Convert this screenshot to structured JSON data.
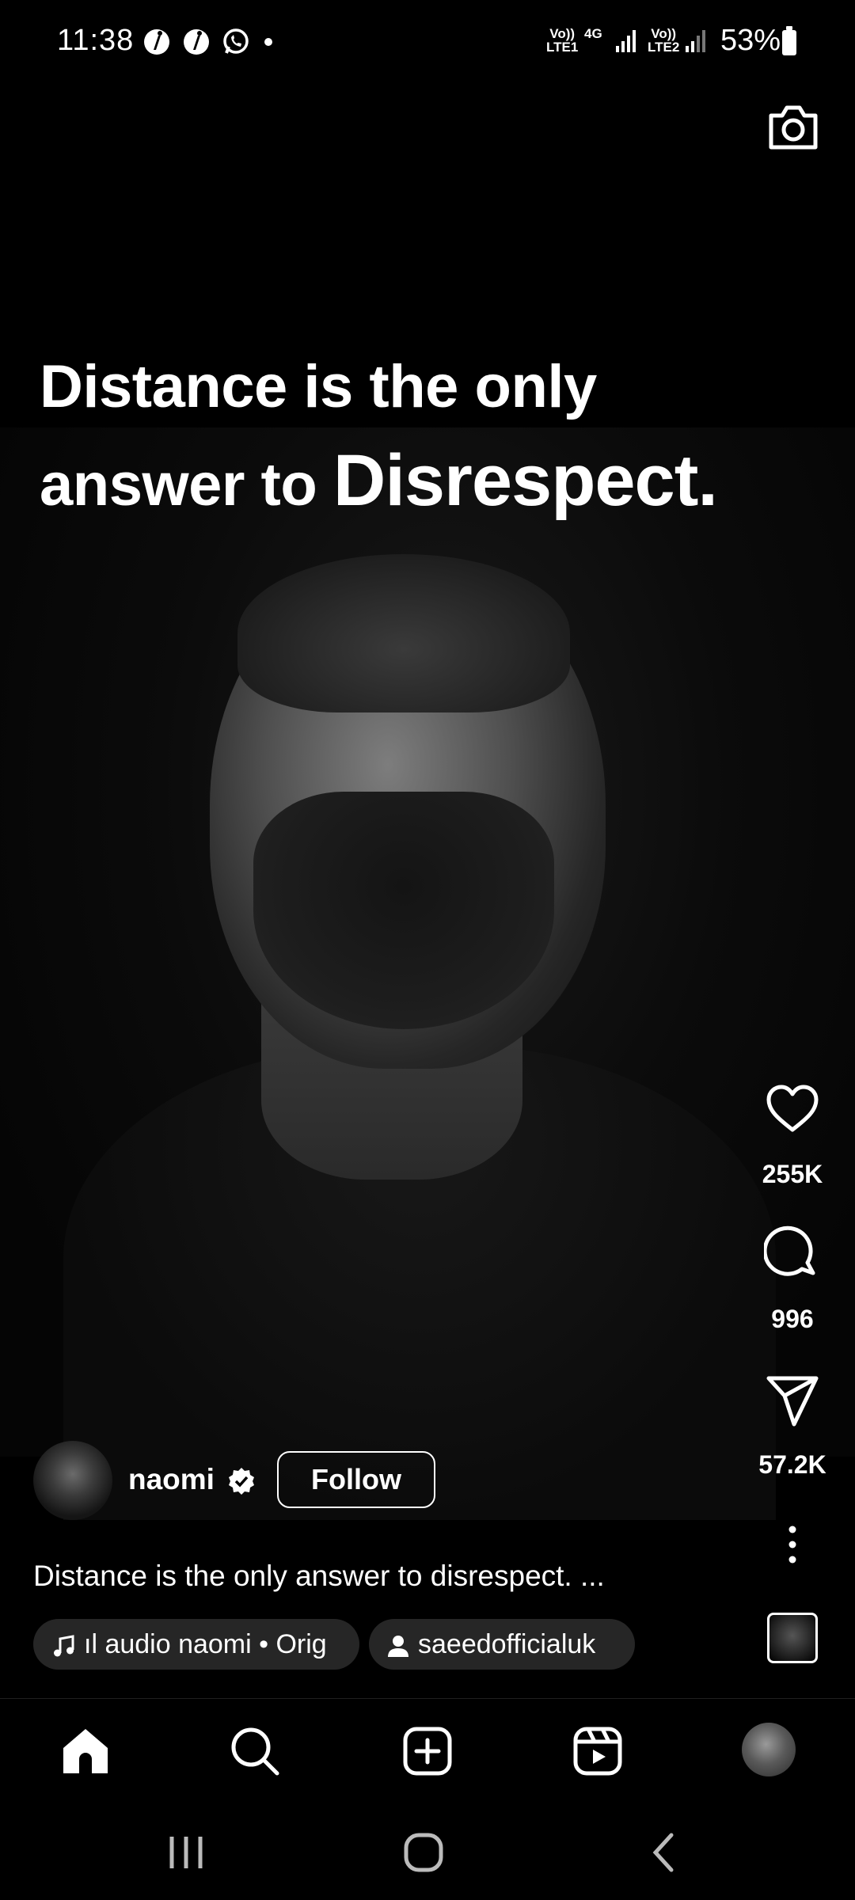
{
  "status_bar": {
    "time": "11:38",
    "network_1": "Vo))\nLTE1",
    "network_type": "4G",
    "network_2": "Vo))\nLTE2",
    "battery": "53%"
  },
  "video": {
    "overlay_line1": "Distance is the only",
    "overlay_line2a": "answer to ",
    "overlay_line2b": "Disrespect."
  },
  "actions": {
    "likes": "255K",
    "comments": "996",
    "shares": "57.2K"
  },
  "author": {
    "username": "naomi",
    "follow_label": "Follow"
  },
  "caption": "Distance is the only answer to disrespect. ...",
  "chips": {
    "audio": "ıl audio   naomi • Orig",
    "tagged_user": "saeedofficialuk"
  },
  "icons": [
    "camera-icon",
    "heart-icon",
    "comment-icon",
    "share-icon",
    "more-icon",
    "verified-icon",
    "music-icon",
    "person-icon",
    "home-icon",
    "search-icon",
    "create-icon",
    "reels-icon",
    "recents-icon",
    "home-circle-icon",
    "back-icon"
  ]
}
